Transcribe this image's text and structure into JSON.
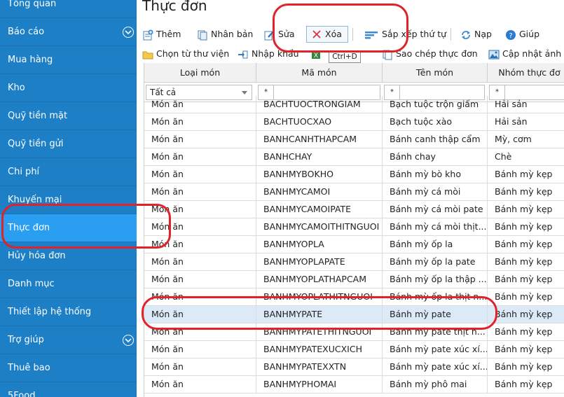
{
  "sidebar": {
    "items": [
      {
        "label": "Tổng quan",
        "chevron": false,
        "active": false
      },
      {
        "label": "Báo cáo",
        "chevron": true,
        "active": false
      },
      {
        "label": "Mua hàng",
        "chevron": false,
        "active": false
      },
      {
        "label": "Kho",
        "chevron": false,
        "active": false
      },
      {
        "label": "Quỹ tiền mặt",
        "chevron": false,
        "active": false
      },
      {
        "label": "Quỹ tiền gửi",
        "chevron": false,
        "active": false
      },
      {
        "label": "Chi phí",
        "chevron": false,
        "active": false
      },
      {
        "label": "Khuyến mại",
        "chevron": false,
        "active": false
      },
      {
        "label": "Thực đơn",
        "chevron": false,
        "active": true
      },
      {
        "label": "Hủy hóa đơn",
        "chevron": false,
        "active": false
      },
      {
        "label": "Danh mục",
        "chevron": false,
        "active": false
      },
      {
        "label": "Thiết lập hệ thống",
        "chevron": false,
        "active": false
      },
      {
        "label": "Trợ giúp",
        "chevron": true,
        "active": false
      },
      {
        "label": "Thuê bao",
        "chevron": false,
        "active": false
      },
      {
        "label": "5Food",
        "chevron": false,
        "active": false
      }
    ]
  },
  "page": {
    "title": "Thực đơn"
  },
  "toolbar1": {
    "add": "Thêm",
    "duplicate": "Nhân bản",
    "edit": "Sửa",
    "delete": "Xóa",
    "sort": "Sắp xếp thứ tự",
    "reload": "Nạp",
    "help": "Giúp"
  },
  "toolbar2": {
    "library": "Chọn từ thư viện",
    "import": "Nhập khẩu",
    "copy_menu": "Sao chép thực đơn",
    "update_image": "Cập nhật ảnh"
  },
  "tooltip": "Ctrl+D",
  "grid": {
    "columns": [
      "Loại món",
      "Mã món",
      "Tên món",
      "Nhóm thực đơ"
    ],
    "filter": {
      "type_value": "Tất cả",
      "star": "*"
    },
    "rows": [
      [
        "Món ăn",
        "BACHTUOCTRONGIAM",
        "Bạch tuộc trộn giấm",
        "Hải sản"
      ],
      [
        "Món ăn",
        "BACHTUOCXAO",
        "Bạch tuộc xào",
        "Hải sản"
      ],
      [
        "Món ăn",
        "BANHCANHTHAPCAM",
        "Bánh canh thập cẩm",
        "Mỳ, cơm"
      ],
      [
        "Món ăn",
        "BANHCHAY",
        "Bánh chay",
        "Chè"
      ],
      [
        "Món ăn",
        "BANHMYBOKHO",
        "Bánh mỳ bò kho",
        "Bánh mỳ kẹp"
      ],
      [
        "Món ăn",
        "BANHMYCAMOI",
        "Bánh mỳ cá mòi",
        "Bánh mỳ kẹp"
      ],
      [
        "Món ăn",
        "BANHMYCAMOIPATE",
        "Bánh mỳ cá mòi pate",
        "Bánh mỳ kẹp"
      ],
      [
        "Món ăn",
        "BANHMYCAMOITHITNGUOI",
        "Bánh mỳ cá mòi thịt...",
        "Bánh mỳ kẹp"
      ],
      [
        "Món ăn",
        "BANHMYOPLA",
        "Bánh mỳ ốp la",
        "Bánh mỳ kẹp"
      ],
      [
        "Món ăn",
        "BANHMYOPLAPATE",
        "Bánh mỳ ốp la pate",
        "Bánh mỳ kẹp"
      ],
      [
        "Món ăn",
        "BANHMYOPLATHAPCAM",
        "Bánh mỳ ốp la thập ...",
        "Bánh mỳ kẹp"
      ],
      [
        "Món ăn",
        "BANHMYOPLATHITNGUOI",
        "Bánh mỳ ốp la thịt n...",
        "Bánh mỳ kẹp"
      ],
      [
        "Món ăn",
        "BANHMYPATE",
        "Bánh mỳ pate",
        "Bánh mỳ kẹp"
      ],
      [
        "Món ăn",
        "BANHMYPATETHITNGUOI",
        "Bánh mỳ pate thịt n...",
        "Bánh mỳ kẹp"
      ],
      [
        "Món ăn",
        "BANHMYPATEXUCXICH",
        "Bánh mỳ pate xúc xí...",
        "Bánh mỳ kẹp"
      ],
      [
        "Món ăn",
        "BANHMYPATEXXTN",
        "Bánh mỳ pate xúc xí...",
        "Bánh mỳ kẹp"
      ],
      [
        "Món ăn",
        "BANHMYPHOMAI",
        "Bánh mỳ phô mai",
        "Bánh mỳ kẹp"
      ]
    ],
    "selected_row": 12
  },
  "colors": {
    "sidebar": "#1d7fc5",
    "sidebar_active": "#2a9ef0",
    "annotation": "#e0222a",
    "selected_row": "#dbeaf6"
  }
}
